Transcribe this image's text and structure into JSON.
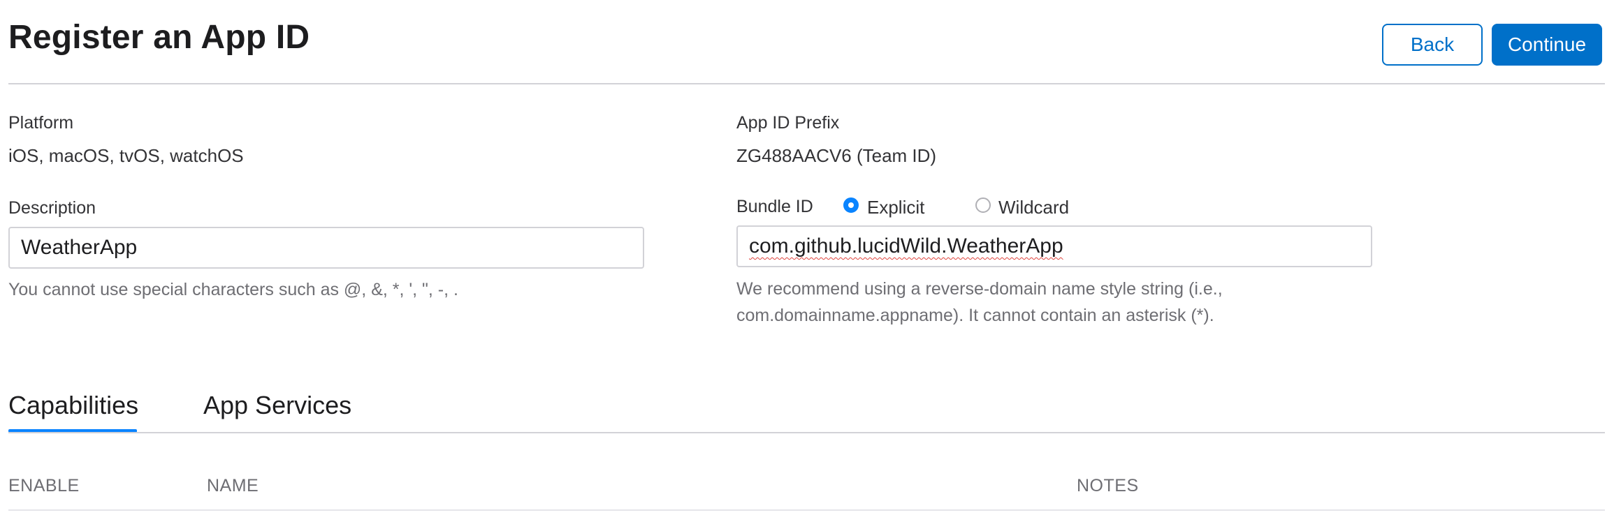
{
  "header": {
    "title": "Register an App ID",
    "back_label": "Back",
    "continue_label": "Continue"
  },
  "platform": {
    "label": "Platform",
    "value": "iOS, macOS, tvOS, watchOS"
  },
  "app_id_prefix": {
    "label": "App ID Prefix",
    "value": "ZG488AACV6 (Team ID)"
  },
  "description": {
    "label": "Description",
    "value": "WeatherApp",
    "hint": "You cannot use special characters such as @, &, *, ', \", -, ."
  },
  "bundle_id": {
    "label": "Bundle ID",
    "options": [
      {
        "label": "Explicit",
        "selected": true
      },
      {
        "label": "Wildcard",
        "selected": false
      }
    ],
    "value": "com.github.lucidWild.WeatherApp",
    "hint_line1": "We recommend using a reverse-domain name style string (i.e.,",
    "hint_line2": "com.domainname.appname). It cannot contain an asterisk (*)."
  },
  "tabs": [
    {
      "label": "Capabilities",
      "active": true
    },
    {
      "label": "App Services",
      "active": false
    }
  ],
  "table": {
    "columns": [
      "ENABLE",
      "NAME",
      "NOTES"
    ]
  },
  "colors": {
    "accent": "#0070c9",
    "radio_selected": "#0a84ff",
    "divider": "#d2d2d7"
  }
}
